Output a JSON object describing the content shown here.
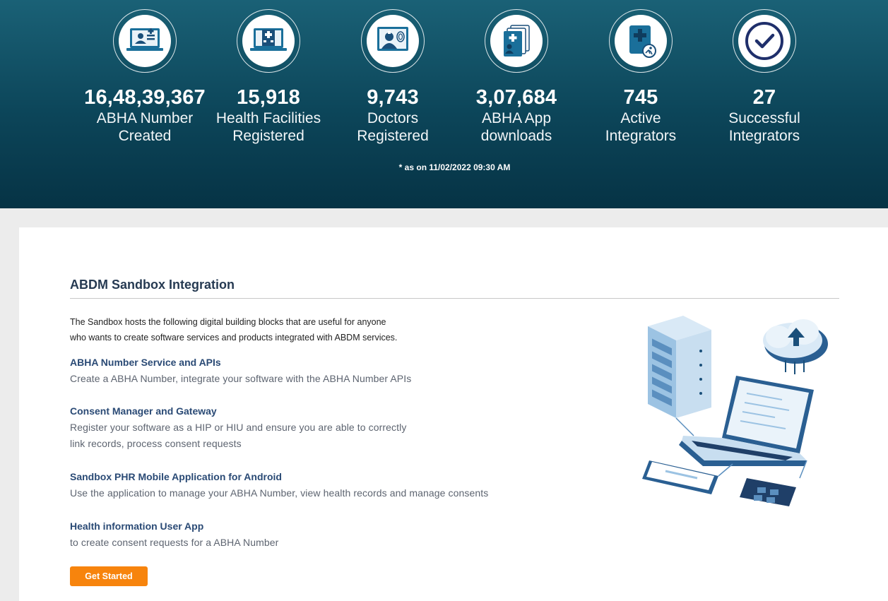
{
  "stats": [
    {
      "value": "16,48,39,367",
      "label1": "ABHA Number",
      "label2": "Created",
      "icon": "abha-card-laptop-icon"
    },
    {
      "value": "15,918",
      "label1": "Health Facilities",
      "label2": "Registered",
      "icon": "hospital-laptop-icon"
    },
    {
      "value": "9,743",
      "label1": "Doctors",
      "label2": "Registered",
      "icon": "doctor-fingerprint-icon"
    },
    {
      "value": "3,07,684",
      "label1": "ABHA App",
      "label2": "downloads",
      "icon": "abha-app-cards-icon"
    },
    {
      "value": "745",
      "label1": "Active",
      "label2": "Integrators",
      "icon": "active-integrator-icon"
    },
    {
      "value": "27",
      "label1": "Successful",
      "label2": "Integrators",
      "icon": "checkmark-icon"
    }
  ],
  "as_of": "* as on 11/02/2022 09:30 AM",
  "section": {
    "title": "ABDM Sandbox Integration",
    "intro_line1": "The Sandbox hosts the following digital building blocks that are useful for anyone",
    "intro_line2": "who wants to create software services and products integrated with ABDM services.",
    "items": [
      {
        "title": "ABHA Number Service and APIs",
        "desc1": "Create a ABHA Number, integrate your software with the ABHA Number APIs",
        "desc2": ""
      },
      {
        "title": "Consent Manager and Gateway",
        "desc1": "Register your software as a HIP or HIU and ensure you are able to correctly",
        "desc2": "link records, process consent requests"
      },
      {
        "title": "Sandbox PHR Mobile Application for Android",
        "desc1": "Use the application to manage your ABHA Number, view health records and manage consents",
        "desc2": ""
      },
      {
        "title": "Health information User App",
        "desc1": "to create consent requests for a ABHA Number",
        "desc2": ""
      }
    ],
    "button_label": "Get Started"
  },
  "colors": {
    "hero_top": "#1a6176",
    "hero_bottom": "#063345",
    "title": "#263a52",
    "item_title": "#2a4a75",
    "button": "#f7840d"
  }
}
